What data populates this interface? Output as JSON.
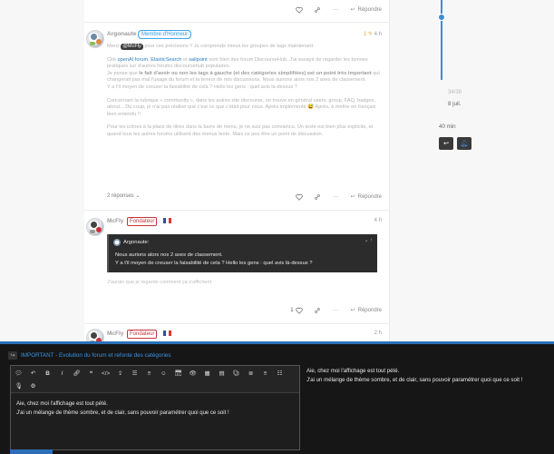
{
  "post1": {
    "actions": {
      "reply_label": "Répondre"
    }
  },
  "post2": {
    "username": "Argonaute",
    "badge": "Membre d'Honneur",
    "edit_count": "1",
    "time": "4 h",
    "mention": "@McFly",
    "p1_lead": "Merci",
    "p1_rest": " pour ces précisions !! Je comprends mieux les groupes de tags maintenant.",
    "p2_a": "Cité",
    "p2_link1": "openAI forum",
    "p2_link2": "ElasticSearch",
    "p2_link3": "sailpoint",
    "p2_b": " sont bien des forum DiscourseHub. J'ai essayé de regarder les bonnes pratiques sur d'autres forums discoursehub populaires.",
    "p2_c": "Je pense que ",
    "p2_bold": "le fait d'avoir ou non les tags à gauche (et des catégories simplifiées) est un point très important",
    "p2_d": " qui changerait pas mal l'usage du forum et la teneur de nos discussions. Nous aurions alors nos 2 axes de classement.",
    "p2_e": "Y a t'il moyen de creuser la faisabilité de cela ? Hello les gens : quel avis là-dessus ?",
    "p3": "Concernant la rubrique « community », dans les autres site discourse, on trouve en général users, group, FAQ, badges, about... Du coup, je n'ai pas réalisé que c'est ce que c'était pour nous. Après implémenté 😅 Après, à mettre en français bien entendu !!",
    "p4": "Pour les icônes à la place de titres dans la barre de menu, je ne suis pas convaincu. Un texte est bien plus explicite, et quand tous les autres forums utilisent des menus texte. Mais ce peu être un point de discussion.",
    "replies": "2 réponses",
    "reply_label": "Répondre"
  },
  "post3": {
    "username": "McFly",
    "badge": "Fondateur",
    "time": "4 h",
    "quote_author": "Argonaute:",
    "quote_line1": "Nous aurions alors nos 2 axes de classement.",
    "quote_line2": "Y a t'il moyen de creuser la faisabilité de cela ? Hello les gens : quel avis là-dessus ?",
    "body": "J'aurais que je regarde comment ça s'affichent",
    "like_count": "1",
    "reply_label": "Répondre"
  },
  "post4": {
    "username": "McFly",
    "badge": "Fondateur",
    "time": "2 h"
  },
  "timeline": {
    "count": "34/38",
    "date": "8 juil.",
    "ago": "40 min"
  },
  "composer": {
    "title_prefix": "IMPORTANT",
    "title_rest": " - Evolution du forum et refonte des catégories",
    "text_line1": "Aie, chez moi l'affichage est tout pété.",
    "text_line2": "J'ai un mélange de thème sombre, et de clair, sans pouvoir paramétrer quoi que ce soit !"
  },
  "colors": {
    "accent": "#3f8dd6",
    "founder_red": "#c8323c",
    "honor_blue": "#3fa4e6",
    "composer_bg": "#161616"
  }
}
